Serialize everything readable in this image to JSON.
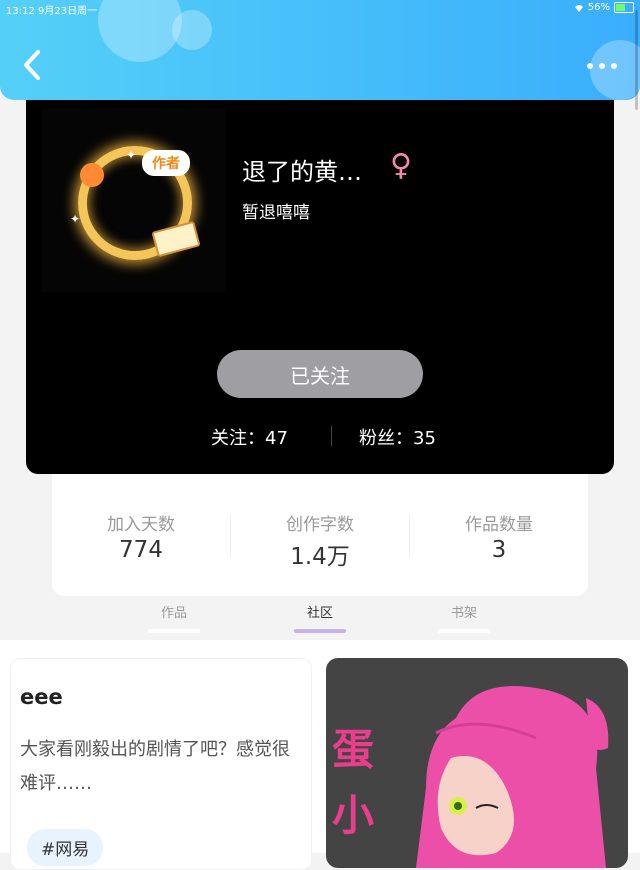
{
  "status_bar": {
    "time_date": "13:12  9月23日周一",
    "battery": "56%"
  },
  "profile": {
    "avatar_badge": "作者",
    "name": "退了的黄…",
    "gender_symbol": "♀",
    "signature": "暂退嘻嘻",
    "follow_button": "已关注",
    "following_label": "关注：47",
    "fans_label": "粉丝：35"
  },
  "stats": [
    {
      "label": "加入天数",
      "value": "774"
    },
    {
      "label": "创作字数",
      "value": "1.4万"
    },
    {
      "label": "作品数量",
      "value": "3"
    }
  ],
  "tabs": [
    {
      "label": "作品",
      "active": false
    },
    {
      "label": "社区",
      "active": true
    },
    {
      "label": "书架",
      "active": false
    }
  ],
  "posts": [
    {
      "title": "eee",
      "text": "大家看刚毅出的剧情了吧？感觉很难评……",
      "tag": "#网易"
    }
  ],
  "image_post": {
    "chars": [
      "蛋",
      "小"
    ]
  },
  "colors": {
    "header_gradient_start": "#54d0f8",
    "header_gradient_end": "#3aaefc",
    "card_bg": "#000000",
    "follow_button_bg": "#9e9ea3",
    "active_tab_indicator": "#c5b2ee",
    "gender_icon": "#f58aa8"
  },
  "icons": {
    "back": "chevron-left-icon",
    "more": "more-dots-icon",
    "wifi": "wifi-icon",
    "battery": "battery-icon"
  }
}
